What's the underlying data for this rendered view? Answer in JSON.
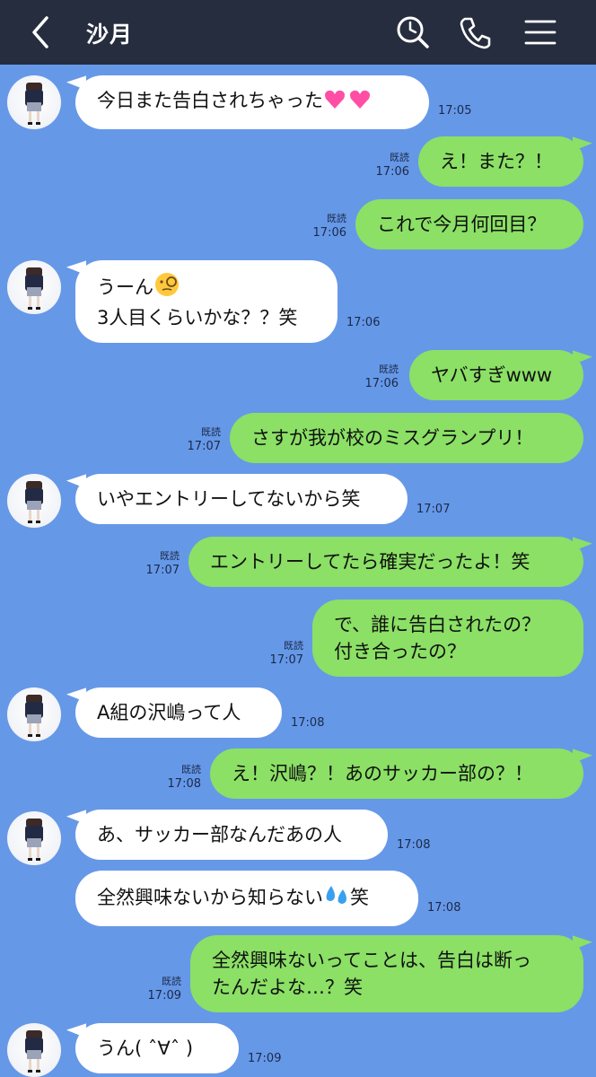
{
  "header": {
    "title": "沙月",
    "back_icon": "chevron-left-icon",
    "search_icon": "search-icon",
    "call_icon": "phone-icon",
    "menu_icon": "menu-icon"
  },
  "colors": {
    "header_bg": "#252d3e",
    "chat_bg": "#6698e8",
    "incoming_bubble": "#ffffff",
    "outgoing_bubble": "#8be065"
  },
  "read_label": "既読",
  "messages": [
    {
      "dir": "in",
      "lines": [
        "今日また告白されちゃった"
      ],
      "emoji": "heart-emoji",
      "time": "17:05"
    },
    {
      "dir": "out",
      "lines": [
        "え！また？！"
      ],
      "time": "17:06",
      "read": true
    },
    {
      "dir": "out",
      "lines": [
        "これで今月何回目？"
      ],
      "time": "17:06",
      "read": true
    },
    {
      "dir": "in",
      "lines": [
        "うーん",
        "3人目くらいかな？？笑"
      ],
      "emoji": "monocle-face-emoji",
      "time": "17:06"
    },
    {
      "dir": "out",
      "lines": [
        "ヤバすぎwww"
      ],
      "time": "17:06",
      "read": true
    },
    {
      "dir": "out",
      "lines": [
        "さすが我が校のミスグランプリ！"
      ],
      "time": "17:07",
      "read": true
    },
    {
      "dir": "in",
      "lines": [
        "いやエントリーしてないから笑"
      ],
      "time": "17:07"
    },
    {
      "dir": "out",
      "lines": [
        "エントリーしてたら確実だったよ！笑"
      ],
      "time": "17:07",
      "read": true
    },
    {
      "dir": "out",
      "lines": [
        "で、誰に告白されたの？",
        "付き合ったの？"
      ],
      "time": "17:07",
      "read": true
    },
    {
      "dir": "in",
      "lines": [
        "A組の沢嶋って人"
      ],
      "time": "17:08"
    },
    {
      "dir": "out",
      "lines": [
        "え！沢嶋？！あのサッカー部の？！"
      ],
      "time": "17:08",
      "read": true
    },
    {
      "dir": "in",
      "lines": [
        "あ、サッカー部なんだあの人"
      ],
      "time": "17:08"
    },
    {
      "dir": "in",
      "lines": [
        "全然興味ないから知らない",
        "笑"
      ],
      "emoji": "sweat-droplets-emoji",
      "time": "17:08"
    },
    {
      "dir": "out",
      "lines": [
        "全然興味ないってことは、告白は断っ",
        "たんだよな…？笑"
      ],
      "time": "17:09",
      "read": true
    },
    {
      "dir": "in",
      "lines": [
        "うん( ˆ∀ˆ )"
      ],
      "time": "17:09"
    }
  ]
}
